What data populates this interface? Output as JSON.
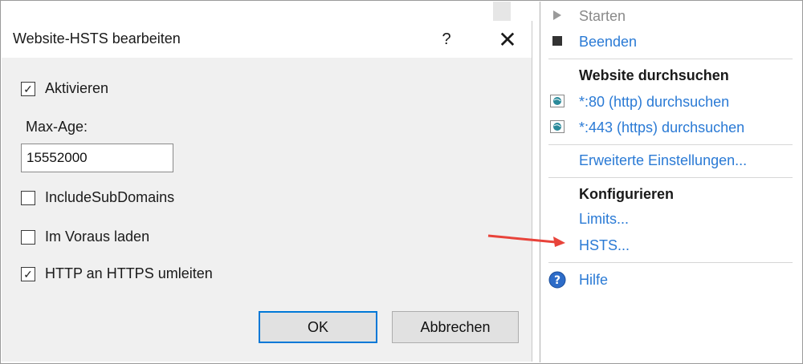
{
  "dialog": {
    "title": "Website-HSTS bearbeiten",
    "help_label": "?",
    "close_label": "✕",
    "enable_label": "Aktivieren",
    "enable_checked": true,
    "max_age_label": "Max-Age:",
    "max_age_value": "15552000",
    "include_subdomains_label": "IncludeSubDomains",
    "include_subdomains_checked": false,
    "preload_label": "Im Voraus laden",
    "preload_checked": false,
    "redirect_label": "HTTP an HTTPS umleiten",
    "redirect_checked": true,
    "ok_label": "OK",
    "cancel_label": "Abbrechen"
  },
  "actions": {
    "start_label": "Starten",
    "stop_label": "Beenden",
    "browse_heading": "Website durchsuchen",
    "browse_http": "*:80 (http) durchsuchen",
    "browse_https": "*:443 (https) durchsuchen",
    "advanced_settings": "Erweiterte Einstellungen...",
    "configure_heading": "Konfigurieren",
    "limits": "Limits...",
    "hsts": "HSTS...",
    "help": "Hilfe"
  },
  "colors": {
    "link": "#2a7ad5",
    "arrow": "#e8433a",
    "ok_border": "#0078d7"
  }
}
